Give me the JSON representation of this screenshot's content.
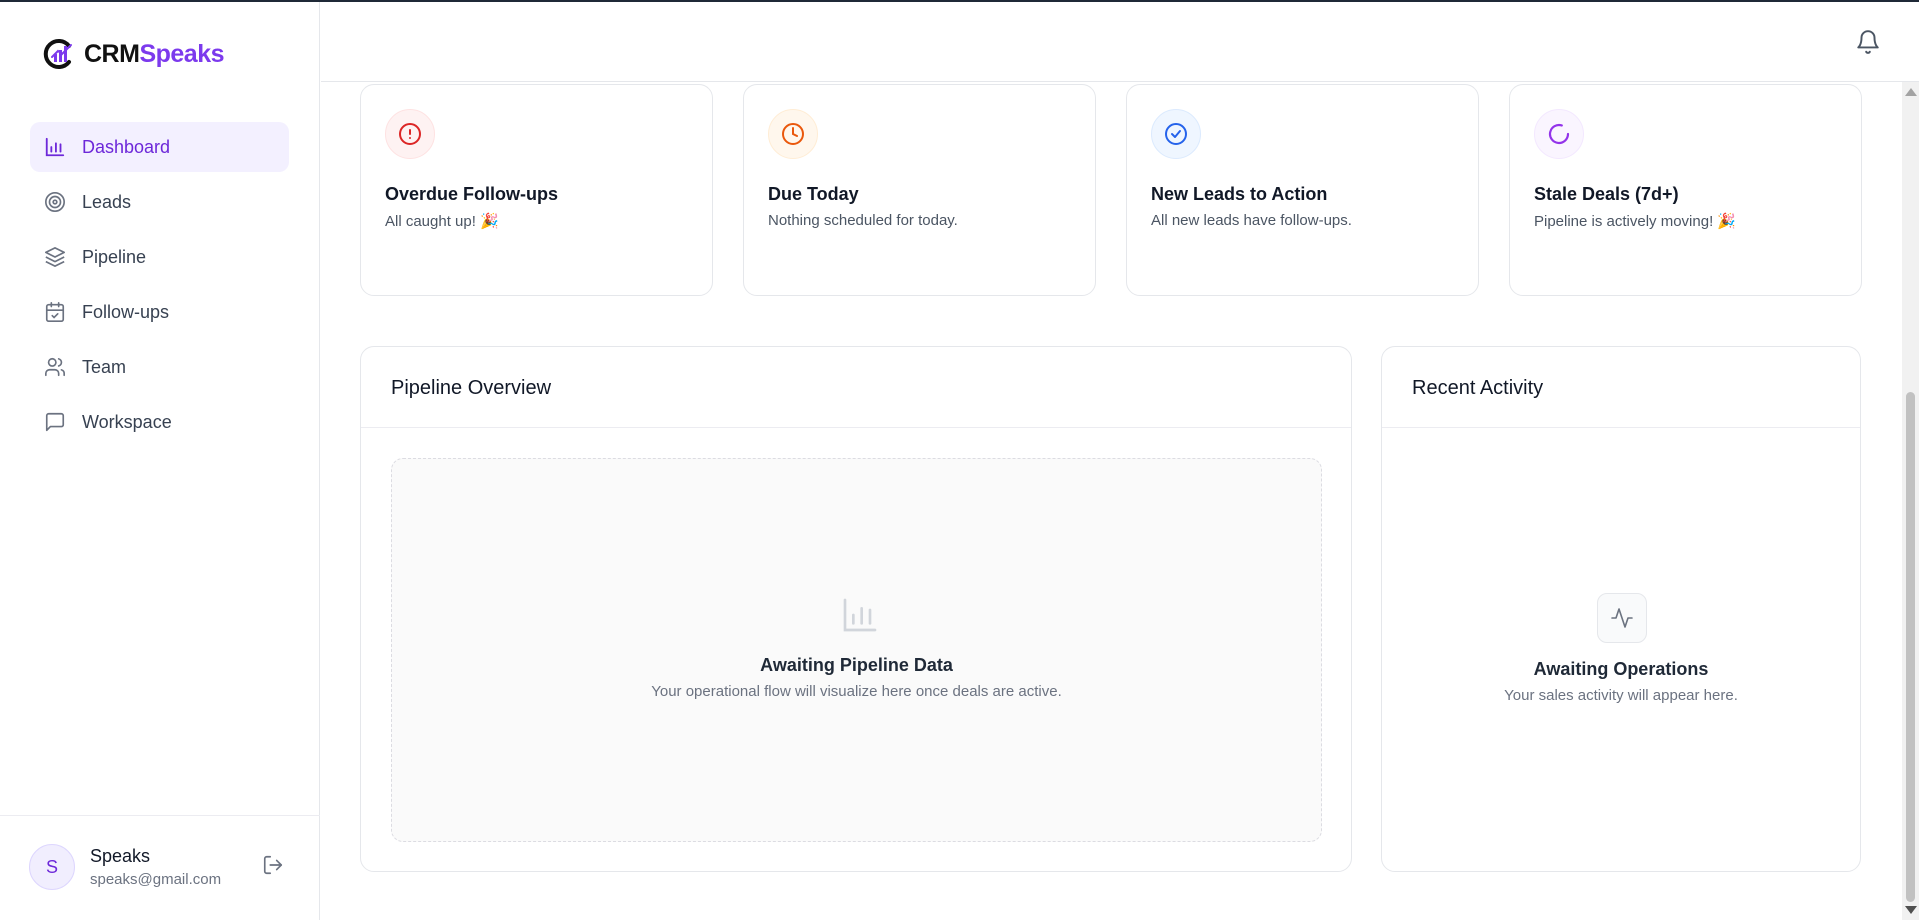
{
  "brand": {
    "name_part1": "CRM",
    "name_part2": "Speaks",
    "logo_icon": "brand-logo-icon",
    "accent_color": "#7c3aed"
  },
  "sidebar": {
    "items": [
      {
        "label": "Dashboard",
        "icon": "bar-chart-icon",
        "active": true
      },
      {
        "label": "Leads",
        "icon": "target-icon",
        "active": false
      },
      {
        "label": "Pipeline",
        "icon": "layers-icon",
        "active": false
      },
      {
        "label": "Follow-ups",
        "icon": "calendar-check-icon",
        "active": false
      },
      {
        "label": "Team",
        "icon": "users-icon",
        "active": false
      },
      {
        "label": "Workspace",
        "icon": "message-square-icon",
        "active": false
      }
    ],
    "user": {
      "initial": "S",
      "name": "Speaks",
      "email": "speaks@gmail.com"
    }
  },
  "header": {
    "notification_icon": "bell-icon"
  },
  "alerts": [
    {
      "title": "Overdue Follow-ups",
      "subtitle": "All caught up! 🎉",
      "icon": "alert-circle-icon",
      "color": "#dc2626"
    },
    {
      "title": "Due Today",
      "subtitle": "Nothing scheduled for today.",
      "icon": "clock-icon",
      "color": "#ea580c"
    },
    {
      "title": "New Leads to Action",
      "subtitle": "All new leads have follow-ups.",
      "icon": "check-circle-icon",
      "color": "#2563eb"
    },
    {
      "title": "Stale Deals (7d+)",
      "subtitle": "Pipeline is actively moving! 🎉",
      "icon": "loader-icon",
      "color": "#9333ea"
    }
  ],
  "pipeline": {
    "title": "Pipeline Overview",
    "empty_title": "Awaiting Pipeline Data",
    "empty_subtitle": "Your operational flow will visualize here once deals are active."
  },
  "activity": {
    "title": "Recent Activity",
    "empty_title": "Awaiting Operations",
    "empty_subtitle": "Your sales activity will appear here."
  }
}
